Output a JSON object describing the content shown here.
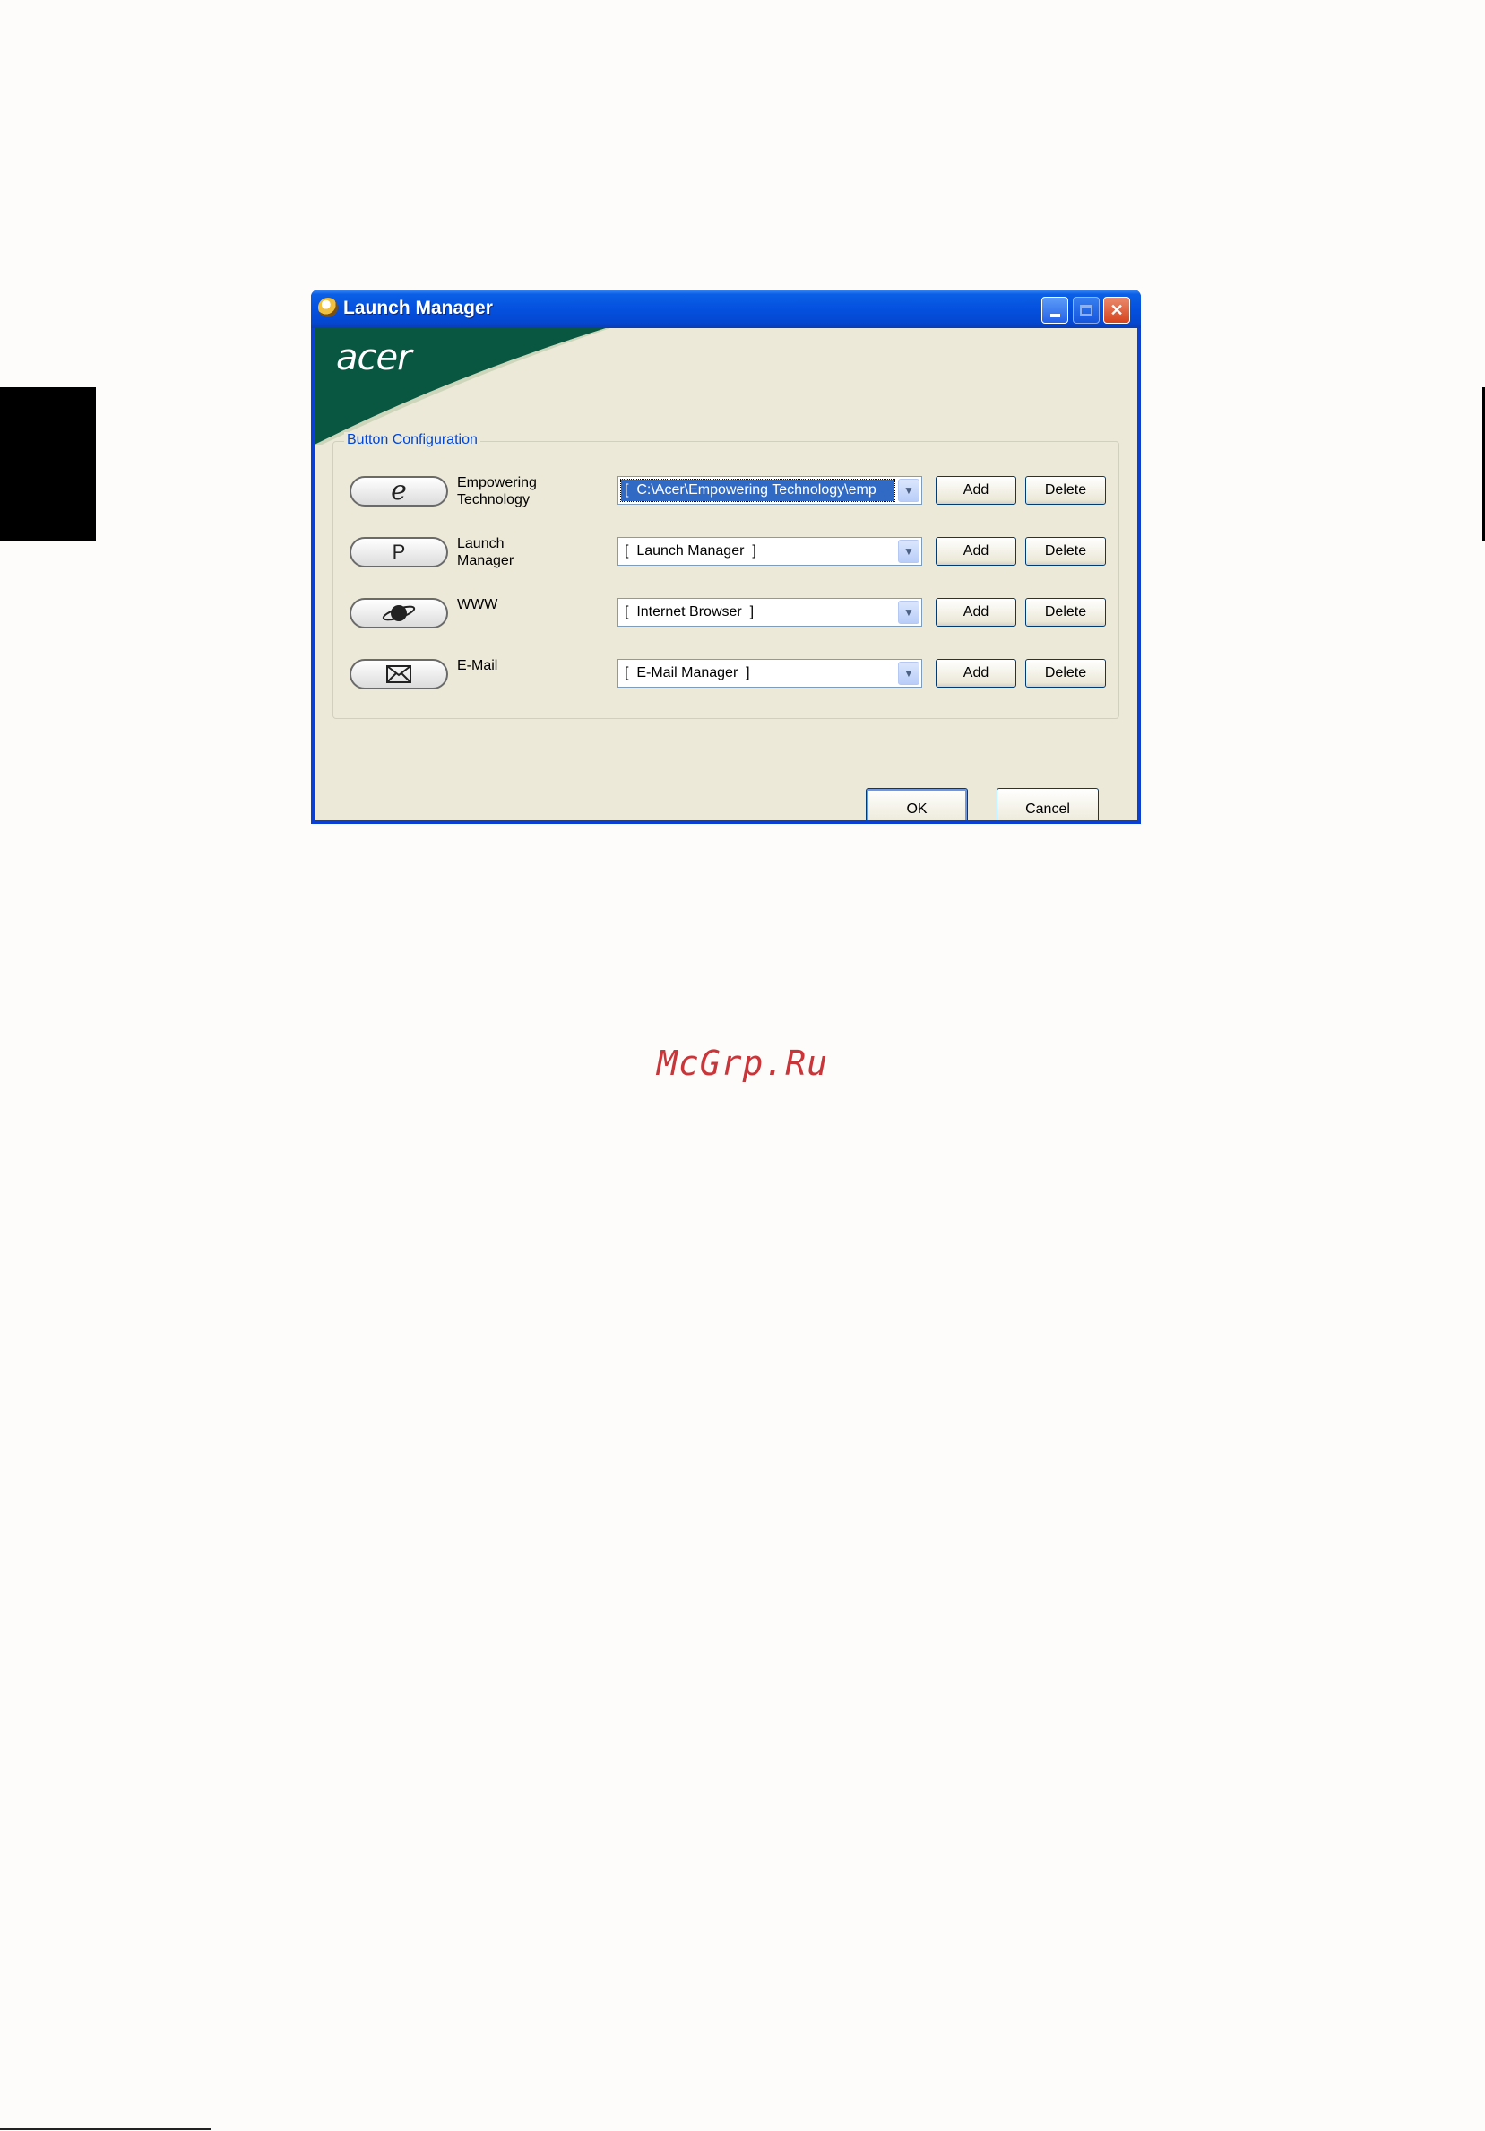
{
  "window": {
    "title": "Launch Manager",
    "brand": "acer",
    "brand_color": "#0a5741",
    "titlebar_color": "#0451df"
  },
  "titlebar_controls": {
    "minimize_icon": "minimize-icon",
    "maximize_icon": "maximize-icon",
    "close_icon": "close-icon",
    "close_glyph": "✕"
  },
  "group": {
    "legend": "Button Configuration"
  },
  "rows": [
    {
      "icon": "e-icon",
      "glyph": "e",
      "label": "Empowering Technology",
      "selection": "[  C:\\Acer\\Empowering Technology\\emp",
      "add": "Add",
      "delete": "Delete"
    },
    {
      "icon": "p-icon",
      "glyph": "P",
      "label": "Launch Manager",
      "selection": "[  Launch Manager  ]",
      "add": "Add",
      "delete": "Delete"
    },
    {
      "icon": "globe-icon",
      "glyph": "",
      "label": "WWW",
      "selection": "[  Internet Browser  ]",
      "add": "Add",
      "delete": "Delete"
    },
    {
      "icon": "envelope-icon",
      "glyph": "",
      "label": "E-Mail",
      "selection": "[  E-Mail Manager  ]",
      "add": "Add",
      "delete": "Delete"
    }
  ],
  "footer": {
    "ok": "OK",
    "cancel": "Cancel"
  },
  "watermark": {
    "text": "McGrp.Ru",
    "color": "#c8363a"
  }
}
